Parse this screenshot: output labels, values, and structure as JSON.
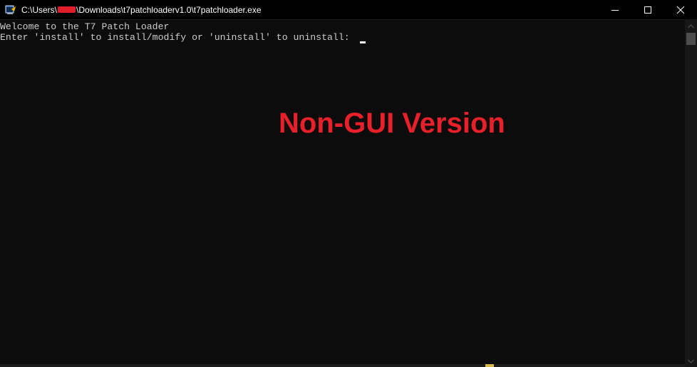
{
  "window": {
    "title_prefix": "C:\\Users\\",
    "title_suffix": "\\Downloads\\t7patchloaderv1.0\\t7patchloader.exe",
    "icons": {
      "app": "console-app-icon",
      "minimize": "minimize-icon",
      "maximize": "maximize-icon",
      "close": "close-icon"
    }
  },
  "console": {
    "line1": "Welcome to the T7 Patch Loader",
    "line2": "Enter 'install' to install/modify or 'uninstall' to uninstall: "
  },
  "overlay": {
    "label": "Non-GUI Version",
    "color": "#e8202a"
  },
  "colors": {
    "console_bg": "#0c0c0c",
    "console_text": "#cccccc",
    "titlebar_bg": "#000000",
    "redaction": "#e11d2a"
  }
}
